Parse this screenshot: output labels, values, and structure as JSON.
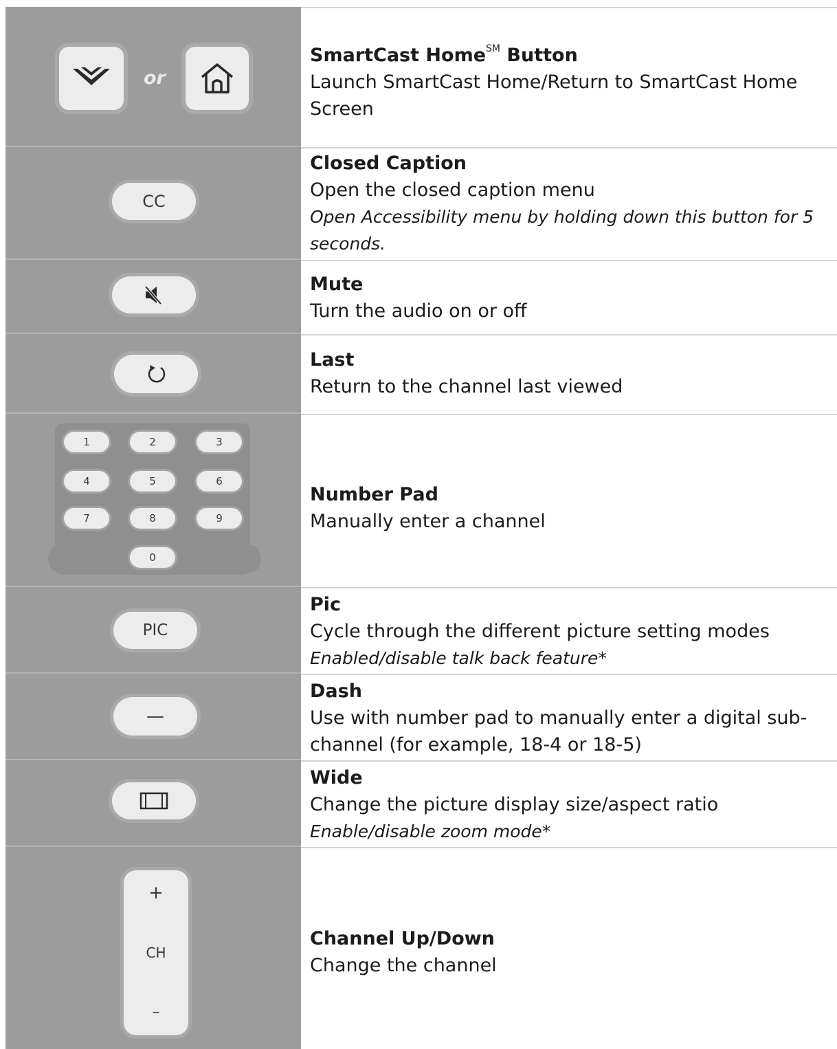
{
  "rows": [
    {
      "title": "SmartCast Home",
      "title_sup": "SM",
      "title_suffix": " Button",
      "lines": [
        "Launch SmartCast Home/Return to SmartCast Home Screen"
      ],
      "or_label": "or",
      "icons": [
        "vizio-v-icon",
        "home-icon"
      ]
    },
    {
      "title": "Closed Caption",
      "lines": [
        "Open the closed caption menu"
      ],
      "note": "Open Accessibility menu by holding down this button for 5 seconds.",
      "button_label": "CC"
    },
    {
      "title": "Mute",
      "lines": [
        "Turn the audio on or off"
      ],
      "icon": "mute-icon"
    },
    {
      "title": "Last",
      "lines": [
        "Return to the channel last viewed"
      ],
      "icon": "last-channel-icon"
    },
    {
      "title": "Number Pad",
      "lines": [
        "Manually enter a channel"
      ],
      "keys": [
        "1",
        "2",
        "3",
        "4",
        "5",
        "6",
        "7",
        "8",
        "9",
        "0"
      ]
    },
    {
      "title": "Pic",
      "lines": [
        "Cycle through the different picture setting modes"
      ],
      "note": "Enabled/disable talk back feature*",
      "button_label": "PIC"
    },
    {
      "title": "Dash",
      "lines": [
        "Use with number pad to manually enter a digital sub-channel (for example, 18-4 or 18-5)"
      ],
      "button_label": "—"
    },
    {
      "title": "Wide",
      "lines": [
        "Change the picture display size/aspect ratio"
      ],
      "note": "Enable/disable zoom mode*",
      "icon": "wide-icon"
    },
    {
      "title": "Channel Up/Down",
      "lines": [
        "Change the channel"
      ],
      "ch_plus": "+",
      "ch_label": "CH",
      "ch_minus": "–"
    }
  ]
}
